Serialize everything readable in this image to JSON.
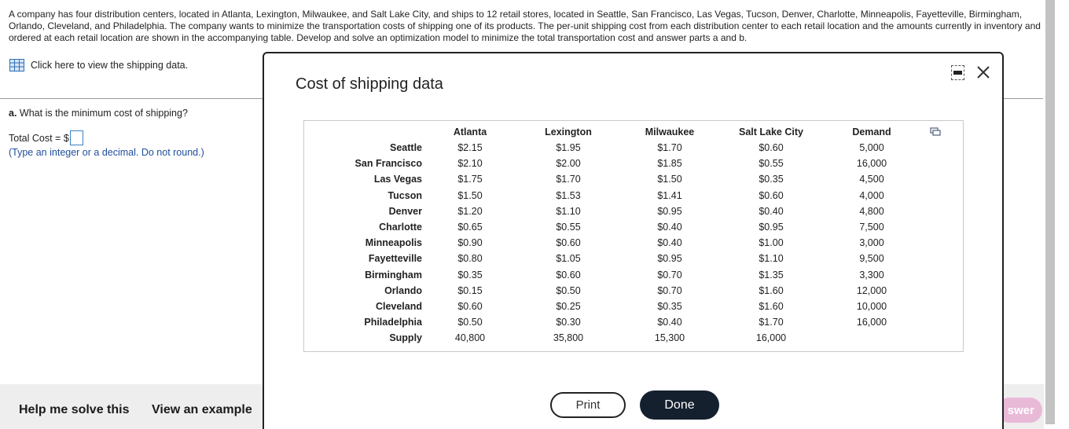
{
  "problem": {
    "text": "A company has four distribution centers, located in Atlanta, Lexington, Milwaukee, and Salt Lake City, and ships to 12 retail stores, located in Seattle, San Francisco, Las Vegas, Tucson, Denver, Charlotte, Minneapolis, Fayetteville, Birmingham, Orlando, Cleveland, and Philadelphia. The company wants to minimize the transportation costs of shipping one of its products. The per-unit shipping cost from each distribution center to each retail location and the amounts currently in inventory and ordered at each retail location are shown in the accompanying table. Develop and solve an optimization model to minimize the total transportation cost and answer parts a and b."
  },
  "shipping_link": {
    "label": "Click here to view the shipping data.",
    "icon": "table-grid-icon"
  },
  "question": {
    "part": "a.",
    "text": "What is the minimum cost of shipping?",
    "answer_label": "Total Cost = $",
    "answer_value": "",
    "hint": "(Type an integer or a decimal. Do not round.)"
  },
  "bottom": {
    "help_label": "Help me solve this",
    "example_label": "View an example",
    "answer_pill_label": "swer"
  },
  "modal": {
    "title": "Cost of shipping data",
    "columns": [
      "",
      "Atlanta",
      "Lexington",
      "Milwaukee",
      "Salt Lake City",
      "Demand"
    ],
    "rows": [
      [
        "Seattle",
        "$2.15",
        "$1.95",
        "$1.70",
        "$0.60",
        "5,000"
      ],
      [
        "San Francisco",
        "$2.10",
        "$2.00",
        "$1.85",
        "$0.55",
        "16,000"
      ],
      [
        "Las Vegas",
        "$1.75",
        "$1.70",
        "$1.50",
        "$0.35",
        "4,500"
      ],
      [
        "Tucson",
        "$1.50",
        "$1.53",
        "$1.41",
        "$0.60",
        "4,000"
      ],
      [
        "Denver",
        "$1.20",
        "$1.10",
        "$0.95",
        "$0.40",
        "4,800"
      ],
      [
        "Charlotte",
        "$0.65",
        "$0.55",
        "$0.40",
        "$0.95",
        "7,500"
      ],
      [
        "Minneapolis",
        "$0.90",
        "$0.60",
        "$0.40",
        "$1.00",
        "3,000"
      ],
      [
        "Fayetteville",
        "$0.80",
        "$1.05",
        "$0.95",
        "$1.10",
        "9,500"
      ],
      [
        "Birmingham",
        "$0.35",
        "$0.60",
        "$0.70",
        "$1.35",
        "3,300"
      ],
      [
        "Orlando",
        "$0.15",
        "$0.50",
        "$0.70",
        "$1.60",
        "12,000"
      ],
      [
        "Cleveland",
        "$0.60",
        "$0.25",
        "$0.35",
        "$1.60",
        "10,000"
      ],
      [
        "Philadelphia",
        "$0.50",
        "$0.30",
        "$0.40",
        "$1.70",
        "16,000"
      ],
      [
        "Supply",
        "40,800",
        "35,800",
        "15,300",
        "16,000",
        ""
      ]
    ],
    "print_label": "Print",
    "done_label": "Done"
  }
}
